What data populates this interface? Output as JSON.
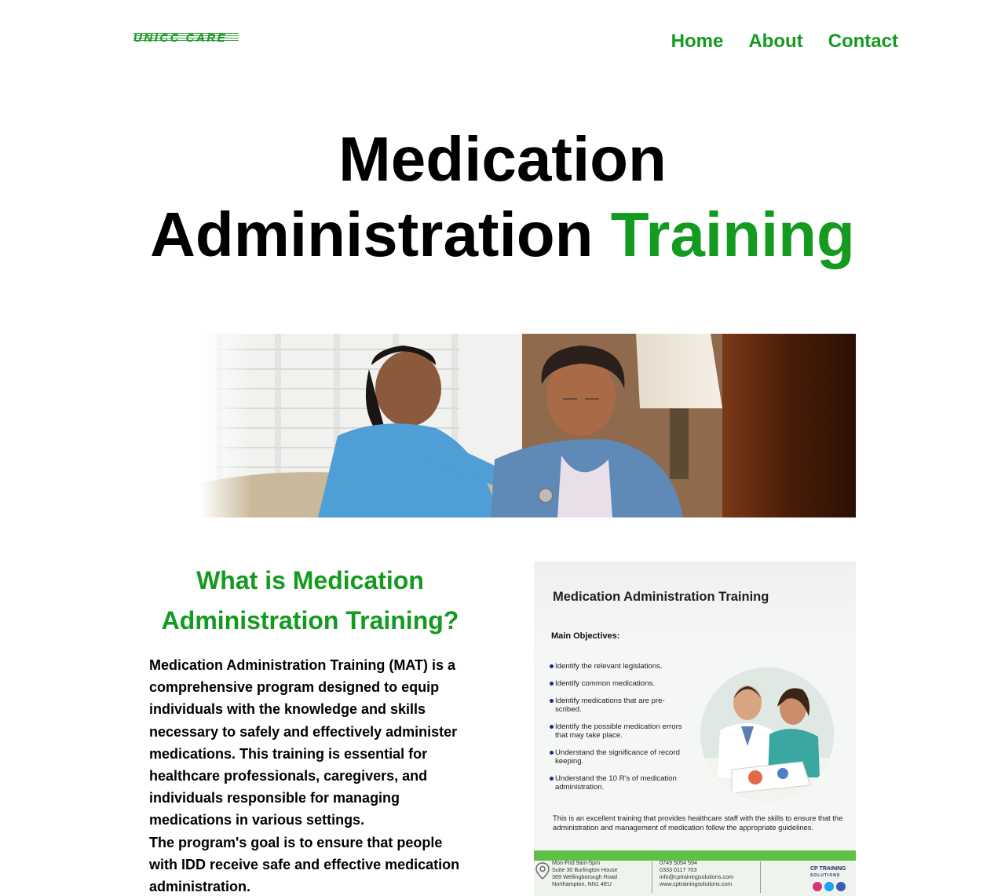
{
  "header": {
    "logo_text": "UNICC CARE",
    "nav": [
      "Home",
      "About",
      "Contact"
    ]
  },
  "hero": {
    "title_line1": "Medication",
    "title_line2_main": "Administration",
    "title_line2_accent": "Training"
  },
  "section": {
    "heading": "What is Medication Administration Training?",
    "paragraph1": "Medication Administration Training (MAT) is a comprehensive program designed to equip individuals with the knowledge and skills necessary to safely and effectively administer medications. This training is essential for healthcare professionals, caregivers, and individuals responsible for managing medications in various settings.",
    "paragraph2": "The program's goal is to ensure that people with IDD receive safe and effective medication administration."
  },
  "flyer": {
    "title": "Medication Administration Training",
    "subtitle": "Main Objectives:",
    "objectives": [
      "Identify the relevant legislations.",
      "Identify common medications.",
      "Identify medications that are pre-scribed.",
      "Identify the possible medication errors that may take place.",
      "Understand the significance of record keeping.",
      "Understand the 10 R's of medication administration."
    ],
    "description": "This is an excellent training that provides healthcare staff with the skills to ensure that the administration and management of medication follow the appropriate guidelines.",
    "contact_left": [
      "Mon-Frid 9am-5pm",
      "Suite 30 Burlington House",
      "369 Wellingborough Road",
      "Northampton, NN1 4EU"
    ],
    "contact_right": [
      "0749 5054 594",
      "0333 0117 703",
      "info@cptrainingsolutions.com",
      "www.cptrainingsolutions.com"
    ],
    "logo_main": "CP TRAINING",
    "logo_sub": "SOLUTIONS"
  },
  "colors": {
    "brand_green": "#139a1f",
    "flyer_green": "#5ec047"
  }
}
